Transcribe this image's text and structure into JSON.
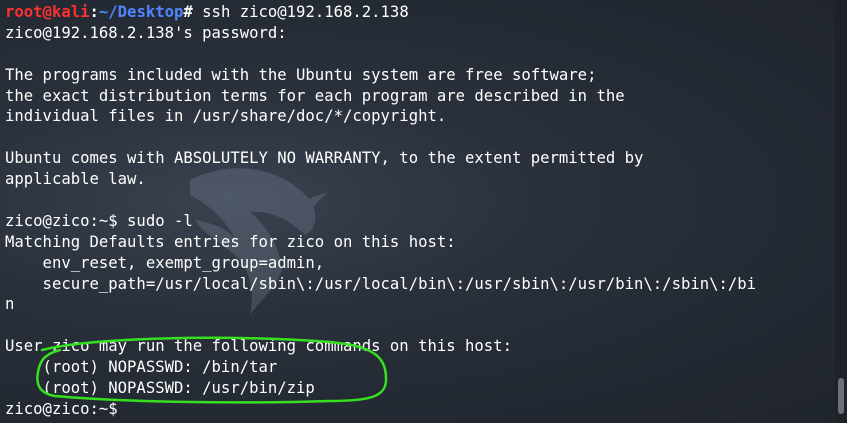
{
  "terminal": {
    "prompt_user": "root@kali",
    "prompt_colon": ":",
    "prompt_path": "~/Desktop",
    "prompt_symbol": "#",
    "command": " ssh zico@192.168.2.138",
    "lines": [
      "zico@192.168.2.138's password:",
      "",
      "The programs included with the Ubuntu system are free software;",
      "the exact distribution terms for each program are described in the",
      "individual files in /usr/share/doc/*/copyright.",
      "",
      "Ubuntu comes with ABSOLUTELY NO WARRANTY, to the extent permitted by",
      "applicable law.",
      "",
      "zico@zico:~$ sudo -l",
      "Matching Defaults entries for zico on this host:",
      "    env_reset, exempt_group=admin,",
      "    secure_path=/usr/local/sbin\\:/usr/local/bin\\:/usr/sbin\\:/usr/bin\\:/sbin\\:/bi",
      "n",
      "",
      "User zico may run the following commands on this host:",
      "    (root) NOPASSWD: /bin/tar",
      "    (root) NOPASSWD: /usr/bin/zip",
      "zico@zico:~$"
    ]
  },
  "colors": {
    "background": "#262c36",
    "prompt_user": "#ff3030",
    "prompt_path": "#4f86ff",
    "annotation": "#35e01e"
  },
  "icons": {
    "watermark": "kali-dragon-icon",
    "annotation": "highlight-circle-icon"
  }
}
